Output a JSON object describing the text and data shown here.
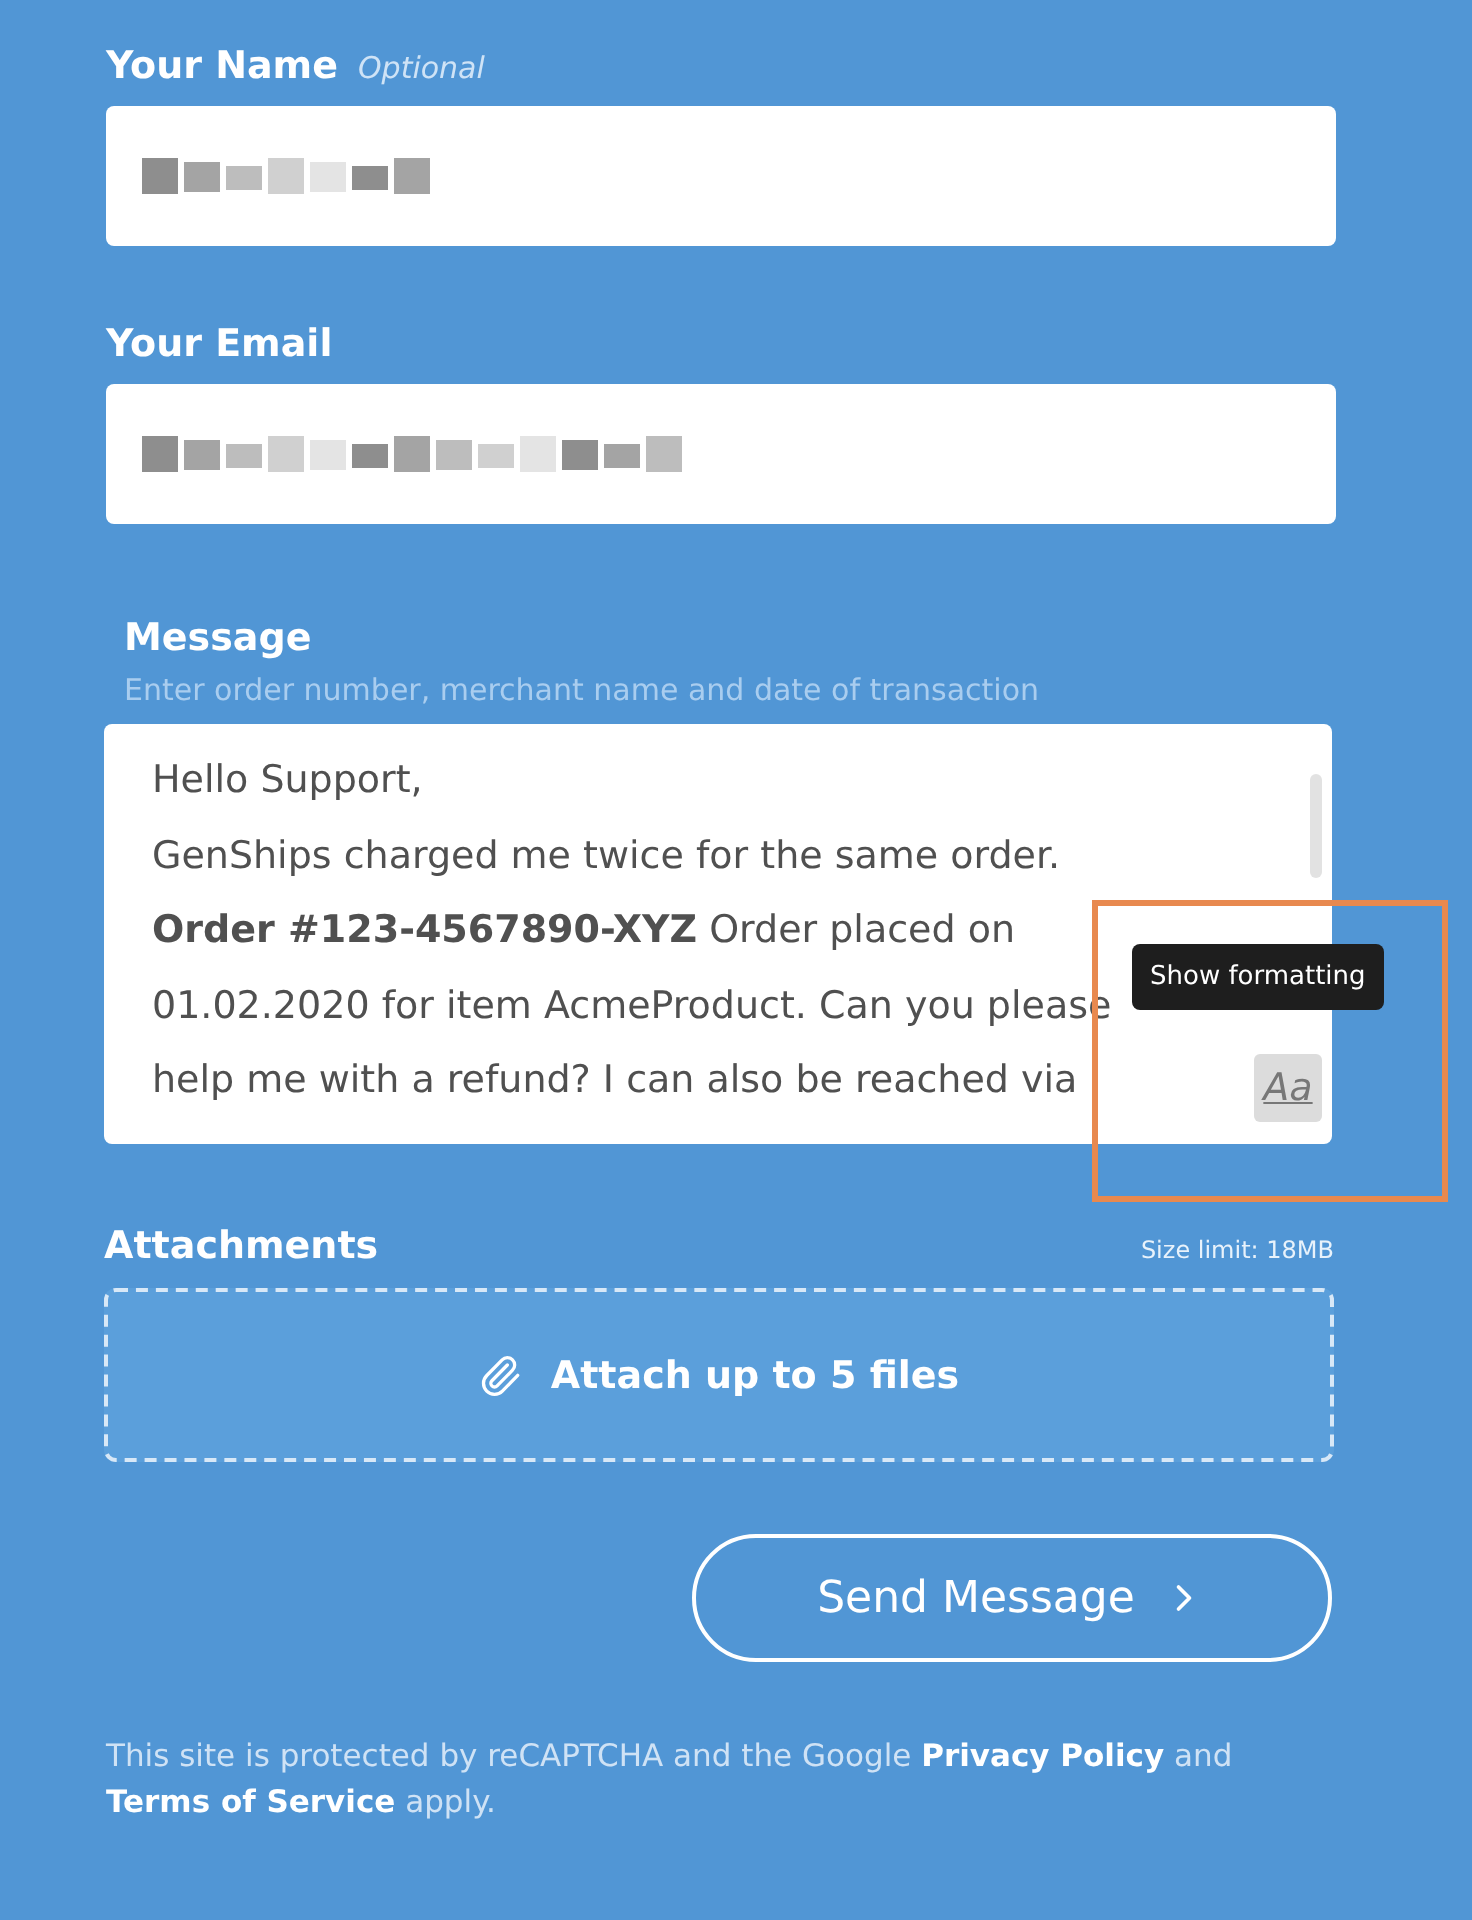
{
  "name_field": {
    "label": "Your Name",
    "hint": "Optional",
    "value_blurred": true
  },
  "email_field": {
    "label": "Your Email",
    "value_blurred": true
  },
  "message": {
    "label": "Message",
    "hint": "Enter order number, merchant name and date of transaction",
    "lines": [
      "Hello Support,",
      "GenShips charged me twice for the same order.",
      "**Order #123-4567890-XYZ** Order placed on",
      "01.02.2020 for item AcmeProduct. Can you please",
      "help me with a refund? I can also be reached via"
    ],
    "format_button": "Aa",
    "tooltip": "Show formatting"
  },
  "attachments": {
    "label": "Attachments",
    "size_limit": "Size limit: 18MB",
    "dropzone": "Attach up to 5 files"
  },
  "send_button": "Send Message",
  "footer": [
    {
      "text": "This site is protected by reCAPTCHA and the Google ",
      "link": false
    },
    {
      "text": "Privacy Policy",
      "link": true
    },
    {
      "text": " and ",
      "link": false
    },
    {
      "text": "Terms of Service",
      "link": true
    },
    {
      "text": " apply.",
      "link": false
    }
  ]
}
